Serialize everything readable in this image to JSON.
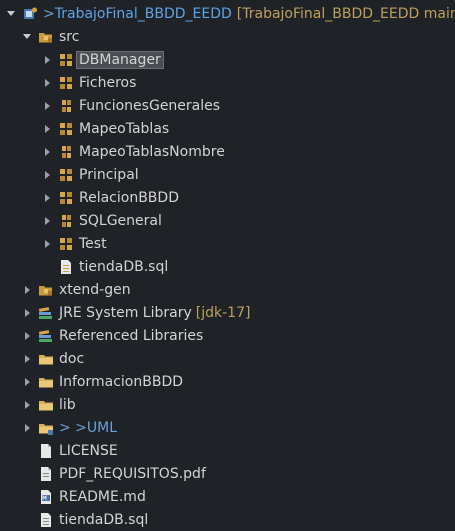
{
  "project": {
    "git_prefix": "> ",
    "name": "TrabajoFinal_BBDD_EEDD",
    "git_branch": "[TrabajoFinal_BBDD_EEDD main]"
  },
  "src": {
    "label": "src",
    "packages": [
      {
        "label": "DBManager",
        "selected": true
      },
      {
        "label": "Ficheros"
      },
      {
        "label": "FuncionesGenerales"
      },
      {
        "label": "MapeoTablas"
      },
      {
        "label": "MapeoTablasNombre"
      },
      {
        "label": "Principal"
      },
      {
        "label": "RelacionBBDD"
      },
      {
        "label": "SQLGeneral"
      },
      {
        "label": "Test"
      }
    ],
    "file": "tiendaDB.sql"
  },
  "root_items": {
    "xtend_gen": "xtend-gen",
    "jre_label": "JRE System Library",
    "jre_version": "[jdk-17]",
    "referenced": "Referenced Libraries",
    "doc": "doc",
    "informacion": "InformacionBBDD",
    "lib": "lib",
    "uml_prefix": "> > ",
    "uml": "UML",
    "license": "LICENSE",
    "pdf": "PDF_REQUISITOS.pdf",
    "readme": "README.md",
    "tienda": "tiendaDB.sql"
  },
  "colors": {
    "background": "#1f2226",
    "text": "#d4d4d4",
    "project": "#5fa3e6",
    "git_info": "#bfa05a",
    "selection": "#4a4d52",
    "package_icon": "#c89b3c"
  },
  "icons": {
    "project": "java-project-icon",
    "source_folder": "source-folder-icon",
    "package": "package-icon",
    "sql_file": "sql-file-icon",
    "library": "library-icon",
    "folder": "folder-icon",
    "file": "file-icon",
    "pdf": "pdf-file-icon",
    "markdown": "markdown-file-icon"
  }
}
